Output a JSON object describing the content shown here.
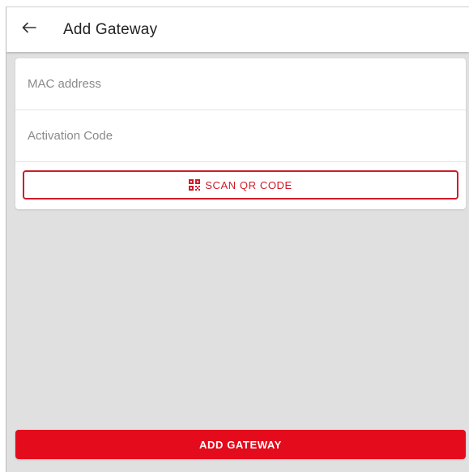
{
  "header": {
    "back_icon": "arrow-left-icon",
    "title": "Add Gateway"
  },
  "form": {
    "mac_placeholder": "MAC address",
    "mac_value": "",
    "code_placeholder": "Activation Code",
    "code_value": "",
    "scan_icon": "qr-code-icon",
    "scan_label": "SCAN QR CODE"
  },
  "footer": {
    "add_label": "ADD GATEWAY"
  },
  "colors": {
    "accent": "#e30b1c",
    "outline": "#d11a2a",
    "background": "#e0e0e0",
    "surface": "#ffffff"
  }
}
